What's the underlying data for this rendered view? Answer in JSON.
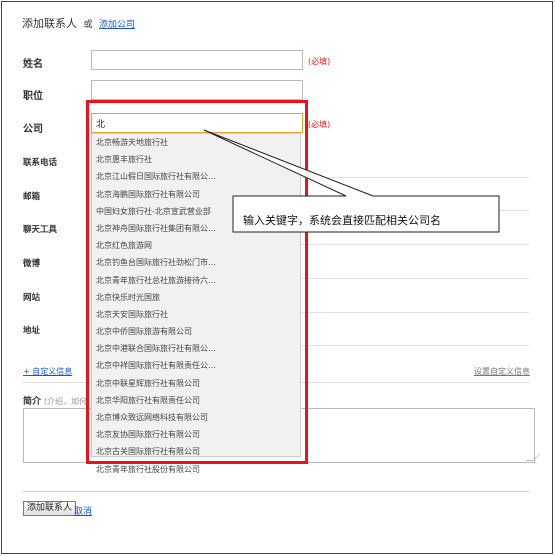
{
  "header": {
    "title": "添加联系人",
    "or": "或",
    "add_company": "添加公司"
  },
  "fields": {
    "name_label": "姓名",
    "position_label": "职位",
    "company_label": "公司",
    "company_value": "北",
    "required": "(必填)",
    "phone_label": "联系电话",
    "email_label": "邮箱",
    "chat_label": "聊天工具",
    "weibo_label": "微博",
    "website_label": "网站",
    "address_label": "地址"
  },
  "custom": {
    "add_link": "+ 自定义信息",
    "setting_link": "设置自定义信息"
  },
  "intro": {
    "label": "简介",
    "hint": "(介绍，如何"
  },
  "actions": {
    "submit": "添加联系人",
    "cancel": "取消"
  },
  "dropdown": {
    "items": [
      "北京畅游天地旅行社",
      "北京惠丰旅行社",
      "北京江山假日国际旅行社有限公...",
      "北京海鹏国际旅行社有限公司",
      "中国妇女旅行社-北京宣武营业部",
      "北京神舟国际旅行社集团有限公...",
      "北京红色旅游网",
      "北京钓鱼台国际旅行社劲松门市...",
      "北京青年旅行社总社旅游接待六...",
      "北京快乐时光国旅",
      "北京天安国际旅行社",
      "北京中侨国际旅游有限公司",
      "北京中港联合国际旅行社有限公...",
      "北京中祥国际旅行社有限责任公...",
      "北京中联星辉旅行社有限公司",
      "北京华阳旅行社有限责任公司",
      "北京博众致远网络科技有限公司",
      "北京友协国际旅行社有限公司",
      "北京古关国际旅行社有限公司",
      "北京青年旅行社股份有限公司"
    ]
  },
  "annotation": {
    "text": "输入关键字，系统会直接匹配相关公司名"
  },
  "colors": {
    "highlight": "#e8141d",
    "link": "#1a55c8",
    "required": "#e02020"
  }
}
